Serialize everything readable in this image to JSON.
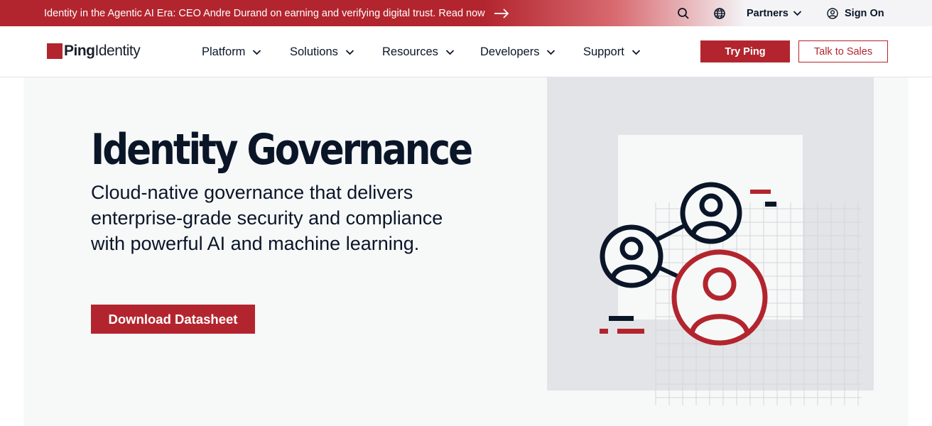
{
  "announcement": {
    "text": "Identity in the Agentic AI Era: CEO Andre Durand on earning and verifying digital trust. Read now",
    "arrow_icon": "arrow-right-icon"
  },
  "utility_nav": {
    "search_icon": "search-icon",
    "globe_icon": "globe-icon",
    "partners_label": "Partners",
    "sign_in_label": "Sign On"
  },
  "brand": {
    "logo_bold": "Ping",
    "logo_light": "Identity",
    "accent_color": "#b3252e",
    "text_color": "#0a1628"
  },
  "main_nav": {
    "items": [
      {
        "label": "Platform"
      },
      {
        "label": "Solutions"
      },
      {
        "label": "Resources"
      },
      {
        "label": "Developers"
      },
      {
        "label": "Support"
      }
    ],
    "try_label": "Try Ping",
    "sales_label": "Talk to Sales"
  },
  "hero": {
    "title": "Identity Governance",
    "subtitle": "Cloud-native governance that delivers enterprise-grade security and compliance with powerful AI and machine learning.",
    "cta_label": "Download Datasheet"
  }
}
